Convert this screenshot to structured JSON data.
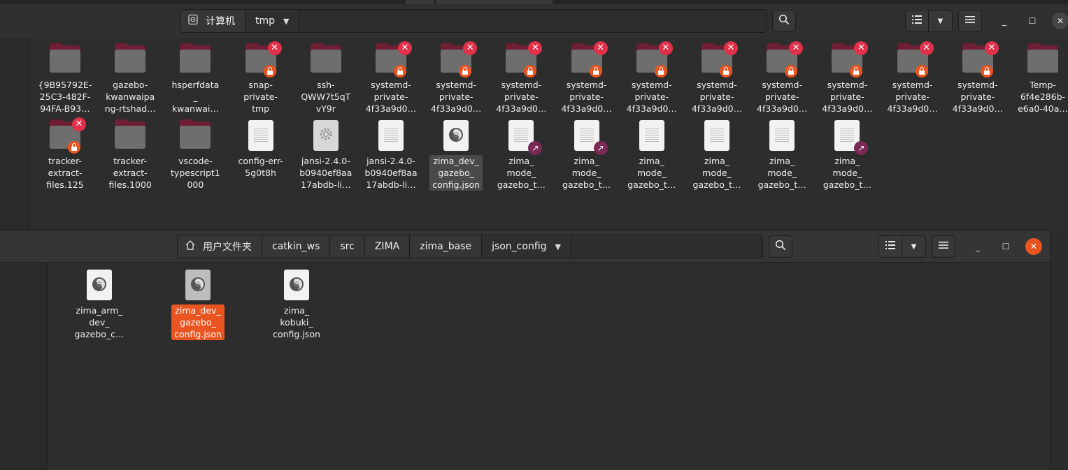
{
  "window_top": {
    "path": {
      "root_label": "计算机",
      "current": "tmp"
    },
    "items": [
      {
        "label": "{9B95792E-\n25C3-482F-\n94FA-B93…",
        "kind": "folder",
        "x_emblem": false,
        "lock_emblem": false
      },
      {
        "label": "gazebo-\nkwanwaipa\nng-rtshad…",
        "kind": "folder",
        "x_emblem": false,
        "lock_emblem": false
      },
      {
        "label": "hsperfdata\n_\nkwanwai…",
        "kind": "folder",
        "x_emblem": false,
        "lock_emblem": false
      },
      {
        "label": "snap-\nprivate-\ntmp",
        "kind": "folder",
        "x_emblem": true,
        "lock_emblem": true
      },
      {
        "label": "ssh-\nQWW7t5qT\nvY9r",
        "kind": "folder",
        "x_emblem": false,
        "lock_emblem": false
      },
      {
        "label": "systemd-\nprivate-\n4f33a9d0…",
        "kind": "folder",
        "x_emblem": true,
        "lock_emblem": true
      },
      {
        "label": "systemd-\nprivate-\n4f33a9d0…",
        "kind": "folder",
        "x_emblem": true,
        "lock_emblem": true
      },
      {
        "label": "systemd-\nprivate-\n4f33a9d0…",
        "kind": "folder",
        "x_emblem": true,
        "lock_emblem": true
      },
      {
        "label": "systemd-\nprivate-\n4f33a9d0…",
        "kind": "folder",
        "x_emblem": true,
        "lock_emblem": true
      },
      {
        "label": "systemd-\nprivate-\n4f33a9d0…",
        "kind": "folder",
        "x_emblem": true,
        "lock_emblem": true
      },
      {
        "label": "systemd-\nprivate-\n4f33a9d0…",
        "kind": "folder",
        "x_emblem": true,
        "lock_emblem": true
      },
      {
        "label": "systemd-\nprivate-\n4f33a9d0…",
        "kind": "folder",
        "x_emblem": true,
        "lock_emblem": true
      },
      {
        "label": "systemd-\nprivate-\n4f33a9d0…",
        "kind": "folder",
        "x_emblem": true,
        "lock_emblem": true
      },
      {
        "label": "systemd-\nprivate-\n4f33a9d0…",
        "kind": "folder",
        "x_emblem": true,
        "lock_emblem": true
      },
      {
        "label": "systemd-\nprivate-\n4f33a9d0…",
        "kind": "folder",
        "x_emblem": true,
        "lock_emblem": true
      },
      {
        "label": "Temp-\n6f4e286b-\ne6a0-40a…",
        "kind": "folder",
        "x_emblem": false,
        "lock_emblem": false
      },
      {
        "label": "tracker-\nextract-\nfiles.125",
        "kind": "folder",
        "x_emblem": true,
        "lock_emblem": true
      },
      {
        "label": "tracker-\nextract-\nfiles.1000",
        "kind": "folder",
        "x_emblem": false,
        "lock_emblem": false
      },
      {
        "label": "vscode-\ntypescript1\n000",
        "kind": "folder",
        "x_emblem": false,
        "lock_emblem": false
      },
      {
        "label": "config-err-\n5g0t8h",
        "kind": "text",
        "link_emblem": false
      },
      {
        "label": "jansi-2.4.0-\nb0940ef8aa\n17abdb-li…",
        "kind": "gear",
        "link_emblem": false
      },
      {
        "label": "jansi-2.4.0-\nb0940ef8aa\n17abdb-li…",
        "kind": "text",
        "link_emblem": false
      },
      {
        "label": "zima_dev_\ngazebo_\nconfig.json",
        "kind": "json",
        "selected": "light"
      },
      {
        "label": "zima_\nmode_\ngazebo_t…",
        "kind": "text",
        "link_emblem": true
      },
      {
        "label": "zima_\nmode_\ngazebo_t…",
        "kind": "text",
        "link_emblem": true
      },
      {
        "label": "zima_\nmode_\ngazebo_t…",
        "kind": "text",
        "link_emblem": false
      },
      {
        "label": "zima_\nmode_\ngazebo_t…",
        "kind": "text",
        "link_emblem": false
      },
      {
        "label": "zima_\nmode_\ngazebo_t…",
        "kind": "text",
        "link_emblem": false
      },
      {
        "label": "zima_\nmode_\ngazebo_t…",
        "kind": "text",
        "link_emblem": true
      }
    ]
  },
  "window_bottom": {
    "path": {
      "home_label": "用户文件夹",
      "segments": [
        "catkin_ws",
        "src",
        "ZIMA",
        "zima_base"
      ],
      "current": "json_config"
    },
    "items": [
      {
        "label": "zima_arm_\ndev_\ngazebo_c…",
        "kind": "json"
      },
      {
        "label": "zima_dev_\ngazebo_\nconfig.json",
        "kind": "json",
        "selected": "orange"
      },
      {
        "label": "zima_\nkobuki_\nconfig.json",
        "kind": "json"
      }
    ]
  },
  "icons": {
    "search": "search-icon",
    "list_view": "list-view-icon",
    "dropdown": "chevron-down-icon",
    "menu": "hamburger-menu-icon",
    "minimize": "minimize-icon",
    "maximize": "maximize-icon",
    "close": "close-icon",
    "home": "home-icon",
    "computer": "computer-icon"
  },
  "colors": {
    "folder_tab": "#6f1e34",
    "folder_body": "#6e6e6e",
    "accent_orange": "#e95420",
    "emblem_red": "#e0304a"
  }
}
